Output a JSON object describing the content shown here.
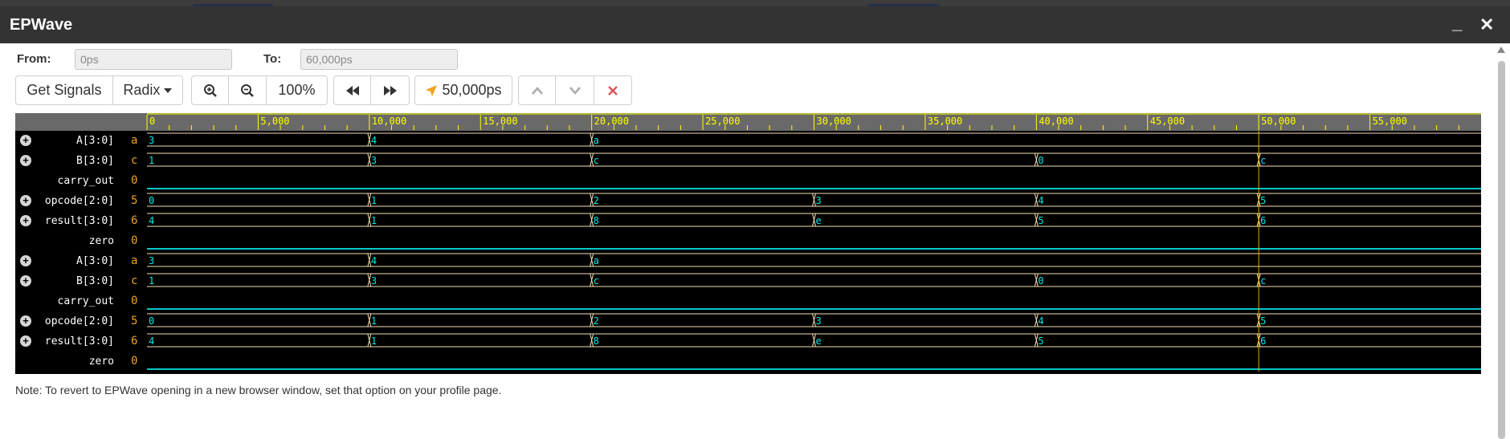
{
  "window": {
    "title": "EPWave",
    "minimize": "_",
    "close": "✕"
  },
  "range": {
    "from_label": "From:",
    "from_value": "0ps",
    "to_label": "To:",
    "to_value": "60,000ps"
  },
  "toolbar": {
    "get_signals": "Get Signals",
    "radix": "Radix",
    "zoom": "100%",
    "cursor_time": "50,000ps",
    "icons": [
      "zoom-in-icon",
      "zoom-out-icon",
      "rewind-icon",
      "fast-forward-icon",
      "cursor-arrow-icon",
      "up-icon",
      "down-icon",
      "close-icon"
    ]
  },
  "colors": {
    "ruler_text": "#ffff00",
    "bus": "#f5deb3",
    "value_text": "#00e5e5",
    "low_line": "#00c8c8",
    "cursor": "#e1a800",
    "signal_value": "#f0a020"
  },
  "waveform": {
    "time_end": 60000,
    "cursor_time": 50000,
    "ruler_ticks": [
      {
        "t": 0,
        "label": "0"
      },
      {
        "t": 5000,
        "label": "5,000"
      },
      {
        "t": 10000,
        "label": "10,000"
      },
      {
        "t": 15000,
        "label": "15,000"
      },
      {
        "t": 20000,
        "label": "20,000"
      },
      {
        "t": 25000,
        "label": "25,000"
      },
      {
        "t": 30000,
        "label": "30,000"
      },
      {
        "t": 35000,
        "label": "35,000"
      },
      {
        "t": 40000,
        "label": "40,000"
      },
      {
        "t": 45000,
        "label": "45,000"
      },
      {
        "t": 50000,
        "label": "50,000"
      },
      {
        "t": 55000,
        "label": "55,000"
      }
    ],
    "signals": [
      {
        "name": "A[3:0]",
        "value": "a",
        "expandable": true,
        "type": "bus",
        "segments": [
          {
            "t": 0,
            "v": "3"
          },
          {
            "t": 10000,
            "v": "4"
          },
          {
            "t": 20000,
            "v": "a"
          }
        ]
      },
      {
        "name": "B[3:0]",
        "value": "c",
        "expandable": true,
        "type": "bus",
        "segments": [
          {
            "t": 0,
            "v": "1"
          },
          {
            "t": 10000,
            "v": "3"
          },
          {
            "t": 20000,
            "v": "c"
          },
          {
            "t": 40000,
            "v": "0"
          },
          {
            "t": 50000,
            "v": "c"
          }
        ]
      },
      {
        "name": "carry_out",
        "value": "0",
        "expandable": false,
        "type": "bit"
      },
      {
        "name": "opcode[2:0]",
        "value": "5",
        "expandable": true,
        "type": "bus",
        "segments": [
          {
            "t": 0,
            "v": "0"
          },
          {
            "t": 10000,
            "v": "1"
          },
          {
            "t": 20000,
            "v": "2"
          },
          {
            "t": 30000,
            "v": "3"
          },
          {
            "t": 40000,
            "v": "4"
          },
          {
            "t": 50000,
            "v": "5"
          }
        ]
      },
      {
        "name": "result[3:0]",
        "value": "6",
        "expandable": true,
        "type": "bus",
        "segments": [
          {
            "t": 0,
            "v": "4"
          },
          {
            "t": 10000,
            "v": "1"
          },
          {
            "t": 20000,
            "v": "8"
          },
          {
            "t": 30000,
            "v": "e"
          },
          {
            "t": 40000,
            "v": "5"
          },
          {
            "t": 50000,
            "v": "6"
          }
        ]
      },
      {
        "name": "zero",
        "value": "0",
        "expandable": false,
        "type": "bit"
      },
      {
        "name": "A[3:0]",
        "value": "a",
        "expandable": true,
        "type": "bus",
        "segments": [
          {
            "t": 0,
            "v": "3"
          },
          {
            "t": 10000,
            "v": "4"
          },
          {
            "t": 20000,
            "v": "a"
          }
        ]
      },
      {
        "name": "B[3:0]",
        "value": "c",
        "expandable": true,
        "type": "bus",
        "segments": [
          {
            "t": 0,
            "v": "1"
          },
          {
            "t": 10000,
            "v": "3"
          },
          {
            "t": 20000,
            "v": "c"
          },
          {
            "t": 40000,
            "v": "0"
          },
          {
            "t": 50000,
            "v": "c"
          }
        ]
      },
      {
        "name": "carry_out",
        "value": "0",
        "expandable": false,
        "type": "bit"
      },
      {
        "name": "opcode[2:0]",
        "value": "5",
        "expandable": true,
        "type": "bus",
        "segments": [
          {
            "t": 0,
            "v": "0"
          },
          {
            "t": 10000,
            "v": "1"
          },
          {
            "t": 20000,
            "v": "2"
          },
          {
            "t": 30000,
            "v": "3"
          },
          {
            "t": 40000,
            "v": "4"
          },
          {
            "t": 50000,
            "v": "5"
          }
        ]
      },
      {
        "name": "result[3:0]",
        "value": "6",
        "expandable": true,
        "type": "bus",
        "segments": [
          {
            "t": 0,
            "v": "4"
          },
          {
            "t": 10000,
            "v": "1"
          },
          {
            "t": 20000,
            "v": "8"
          },
          {
            "t": 30000,
            "v": "e"
          },
          {
            "t": 40000,
            "v": "5"
          },
          {
            "t": 50000,
            "v": "6"
          }
        ]
      },
      {
        "name": "zero",
        "value": "0",
        "expandable": false,
        "type": "bit"
      }
    ]
  },
  "note": "Note: To revert to EPWave opening in a new browser window, set that option on your profile page."
}
